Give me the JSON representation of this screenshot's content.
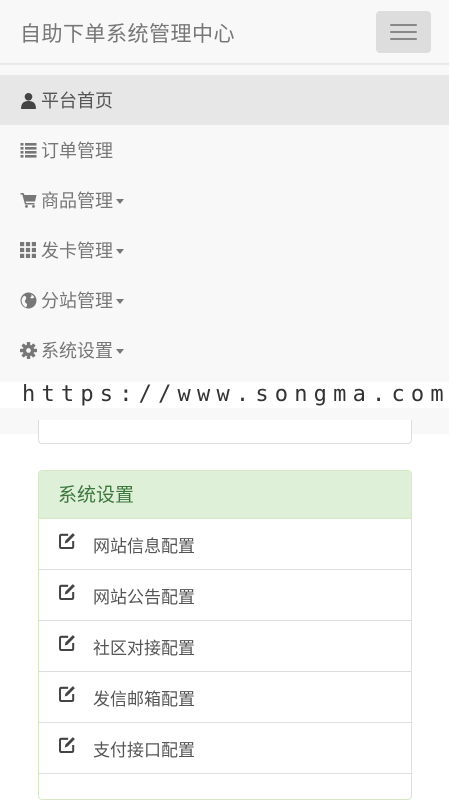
{
  "navbar": {
    "brand": "自助下单系统管理中心",
    "toggle_icon": "hamburger-icon"
  },
  "menu": {
    "items": [
      {
        "label": "平台首页",
        "icon": "user-icon",
        "dropdown": false,
        "active": true
      },
      {
        "label": "订单管理",
        "icon": "list-icon",
        "dropdown": false,
        "active": false
      },
      {
        "label": "商品管理",
        "icon": "shopping-cart-icon",
        "dropdown": true,
        "active": false
      },
      {
        "label": "发卡管理",
        "icon": "grid-icon",
        "dropdown": true,
        "active": false
      },
      {
        "label": "分站管理",
        "icon": "globe-icon",
        "dropdown": true,
        "active": false
      },
      {
        "label": "系统设置",
        "icon": "gear-icon",
        "dropdown": true,
        "active": false
      }
    ]
  },
  "watermark": "https://www.songma.com",
  "settings_panel": {
    "title": "系统设置",
    "items": [
      {
        "label": "网站信息配置",
        "icon": "edit-icon"
      },
      {
        "label": "网站公告配置",
        "icon": "edit-icon"
      },
      {
        "label": "社区对接配置",
        "icon": "edit-icon"
      },
      {
        "label": "发信邮箱配置",
        "icon": "edit-icon"
      },
      {
        "label": "支付接口配置",
        "icon": "edit-icon"
      }
    ]
  },
  "colors": {
    "navbar_bg": "#f8f8f8",
    "active_bg": "#e7e7e7",
    "panel_heading_bg": "#dff0d8",
    "panel_heading_text": "#3c763d"
  }
}
